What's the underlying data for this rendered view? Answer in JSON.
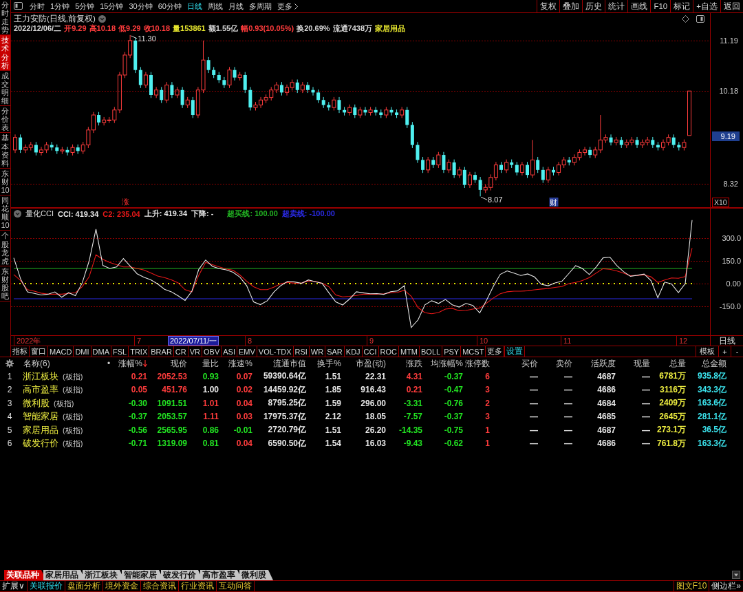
{
  "sidebar": {
    "items": [
      {
        "label": "分时走势",
        "selected": false
      },
      {
        "label": "技术分析",
        "selected": true
      },
      {
        "label": "成交明细",
        "selected": false
      },
      {
        "label": "分价表",
        "selected": false
      },
      {
        "label": "基本资料",
        "selected": false
      },
      {
        "label": "东财10",
        "selected": false
      },
      {
        "label": "同花顺10",
        "selected": false
      },
      {
        "label": "个股龙虎",
        "selected": false
      },
      {
        "label": "东财股吧",
        "selected": false
      }
    ]
  },
  "toolbar": {
    "periods": [
      {
        "label": "分时",
        "selected": false
      },
      {
        "label": "1分钟",
        "selected": false
      },
      {
        "label": "5分钟",
        "selected": false
      },
      {
        "label": "15分钟",
        "selected": false
      },
      {
        "label": "30分钟",
        "selected": false
      },
      {
        "label": "60分钟",
        "selected": false
      },
      {
        "label": "日线",
        "selected": true
      },
      {
        "label": "周线",
        "selected": false
      },
      {
        "label": "月线",
        "selected": false
      },
      {
        "label": "多周期",
        "selected": false
      }
    ],
    "more": "更多",
    "actions": [
      "复权",
      "叠加",
      "历史",
      "统计",
      "画线",
      "F10",
      "标记",
      "+自选",
      "返回"
    ]
  },
  "stock": {
    "title": "王力安防(日线,前复权)",
    "stats": [
      {
        "text": "2022/12/06/二",
        "color": "#d6d6d6"
      },
      {
        "text": "开9.29",
        "color": "#ff3c3c"
      },
      {
        "text": "高10.18",
        "color": "#ff3c3c"
      },
      {
        "text": "低9.29",
        "color": "#ff3c3c"
      },
      {
        "text": "收10.18",
        "color": "#ff3c3c"
      },
      {
        "text": "量153861",
        "color": "#e6e62e"
      },
      {
        "text": "额1.55亿",
        "color": "#d6d6d6"
      },
      {
        "text": "幅0.93(10.05%)",
        "color": "#ff3c3c"
      },
      {
        "text": "换20.69%",
        "color": "#d6d6d6"
      },
      {
        "text": "流通7438万",
        "color": "#d6d6d6"
      },
      {
        "text": "家居用品",
        "color": "#e6e62e"
      }
    ]
  },
  "price_chart": {
    "cursor_price": "9.19",
    "scale": "X10",
    "markers": [
      {
        "text": "涨",
        "kind": "limit"
      },
      {
        "text": "财",
        "kind": "finance"
      }
    ],
    "chart_data": {
      "type": "candlestick",
      "ohlc": [
        [
          9.0,
          9.31,
          8.94,
          9.25
        ],
        [
          9.25,
          9.31,
          8.94,
          9.0
        ],
        [
          9.0,
          9.11,
          8.94,
          9.05
        ],
        [
          9.05,
          9.16,
          8.99,
          9.1
        ],
        [
          9.1,
          9.16,
          8.89,
          8.95
        ],
        [
          8.95,
          9.06,
          8.89,
          9.0
        ],
        [
          9.0,
          9.16,
          8.94,
          9.1
        ],
        [
          9.1,
          9.16,
          8.99,
          9.05
        ],
        [
          9.05,
          9.11,
          8.92,
          8.98
        ],
        [
          8.98,
          9.06,
          8.92,
          9.0
        ],
        [
          9.0,
          9.06,
          8.89,
          8.95
        ],
        [
          8.95,
          9.11,
          8.89,
          9.05
        ],
        [
          9.05,
          9.11,
          8.92,
          8.98
        ],
        [
          8.98,
          9.16,
          8.92,
          9.1
        ],
        [
          9.1,
          9.46,
          9.04,
          9.4
        ],
        [
          9.4,
          9.76,
          9.34,
          9.7
        ],
        [
          9.7,
          9.76,
          9.49,
          9.55
        ],
        [
          9.55,
          9.66,
          9.49,
          9.6
        ],
        [
          9.6,
          9.66,
          9.54,
          9.6
        ],
        [
          9.6,
          9.86,
          9.54,
          9.8
        ],
        [
          9.8,
          10.56,
          9.74,
          10.5
        ],
        [
          10.5,
          10.96,
          10.44,
          10.9
        ],
        [
          10.9,
          11.3,
          10.84,
          11.19
        ],
        [
          11.19,
          11.25,
          10.54,
          10.6
        ],
        [
          10.6,
          10.66,
          10.24,
          10.3
        ],
        [
          10.3,
          10.56,
          10.24,
          10.5
        ],
        [
          10.5,
          10.56,
          10.04,
          10.1
        ],
        [
          10.1,
          10.26,
          10.04,
          10.2
        ],
        [
          10.2,
          10.26,
          9.94,
          10.0
        ],
        [
          10.0,
          10.36,
          9.94,
          10.3
        ],
        [
          10.3,
          10.36,
          10.04,
          10.1
        ],
        [
          10.1,
          10.26,
          10.04,
          10.2
        ],
        [
          10.2,
          10.26,
          9.84,
          9.9
        ],
        [
          9.9,
          10.06,
          9.84,
          10.0
        ],
        [
          10.0,
          10.06,
          9.64,
          9.7
        ],
        [
          9.7,
          10.26,
          9.64,
          10.2
        ],
        [
          10.2,
          11.19,
          10.14,
          10.8
        ],
        [
          10.8,
          10.86,
          10.54,
          10.6
        ],
        [
          10.6,
          10.66,
          10.44,
          10.5
        ],
        [
          10.5,
          10.56,
          10.34,
          10.4
        ],
        [
          10.4,
          10.46,
          10.24,
          10.3
        ],
        [
          10.3,
          10.66,
          10.24,
          10.6
        ],
        [
          10.6,
          10.66,
          10.39,
          10.45
        ],
        [
          10.45,
          10.56,
          10.39,
          10.5
        ],
        [
          10.5,
          10.56,
          10.14,
          10.2
        ],
        [
          10.2,
          10.26,
          9.79,
          9.85
        ],
        [
          9.85,
          9.96,
          9.79,
          9.9
        ],
        [
          9.9,
          10.06,
          9.84,
          10.0
        ],
        [
          10.0,
          10.11,
          9.94,
          10.05
        ],
        [
          10.05,
          10.26,
          9.99,
          10.2
        ],
        [
          10.2,
          10.36,
          10.14,
          10.3
        ],
        [
          10.3,
          10.36,
          10.09,
          10.15
        ],
        [
          10.15,
          10.31,
          10.09,
          10.25
        ],
        [
          10.25,
          10.41,
          10.19,
          10.35
        ],
        [
          10.35,
          10.41,
          10.14,
          10.2
        ],
        [
          10.2,
          10.36,
          10.14,
          10.3
        ],
        [
          10.3,
          10.36,
          10.14,
          10.2
        ],
        [
          10.2,
          10.26,
          10.09,
          10.15
        ],
        [
          10.15,
          10.21,
          9.94,
          10.0
        ],
        [
          10.0,
          10.06,
          9.84,
          9.9
        ],
        [
          9.9,
          9.96,
          9.79,
          9.85
        ],
        [
          9.85,
          10.06,
          9.79,
          10.0
        ],
        [
          10.0,
          10.06,
          9.74,
          9.8
        ],
        [
          9.8,
          9.86,
          9.69,
          9.75
        ],
        [
          9.75,
          9.91,
          9.69,
          9.85
        ],
        [
          9.85,
          9.91,
          9.64,
          9.7
        ],
        [
          9.7,
          9.86,
          9.64,
          9.8
        ],
        [
          9.8,
          9.86,
          9.69,
          9.75
        ],
        [
          9.75,
          9.86,
          9.69,
          9.8
        ],
        [
          9.8,
          9.86,
          9.69,
          9.75
        ],
        [
          9.75,
          9.81,
          9.64,
          9.7
        ],
        [
          9.7,
          9.86,
          9.64,
          9.8
        ],
        [
          9.8,
          9.86,
          9.69,
          9.75
        ],
        [
          9.75,
          9.81,
          9.64,
          9.7
        ],
        [
          9.7,
          9.86,
          9.64,
          9.8
        ],
        [
          9.8,
          9.86,
          9.44,
          9.5
        ],
        [
          9.5,
          9.56,
          9.04,
          9.1
        ],
        [
          9.1,
          9.16,
          8.74,
          8.8
        ],
        [
          8.8,
          8.86,
          8.54,
          8.6
        ],
        [
          8.6,
          8.86,
          8.54,
          8.8
        ],
        [
          8.8,
          8.86,
          8.64,
          8.7
        ],
        [
          8.7,
          8.96,
          8.64,
          8.9
        ],
        [
          8.9,
          8.96,
          8.54,
          8.6
        ],
        [
          8.6,
          8.81,
          8.54,
          8.75
        ],
        [
          8.75,
          8.81,
          8.44,
          8.5
        ],
        [
          8.5,
          8.66,
          8.44,
          8.6
        ],
        [
          8.6,
          8.66,
          8.24,
          8.3
        ],
        [
          8.3,
          8.56,
          8.24,
          8.5
        ],
        [
          8.5,
          8.56,
          8.34,
          8.4
        ],
        [
          8.4,
          8.46,
          8.07,
          8.2
        ],
        [
          8.2,
          8.31,
          8.14,
          8.25
        ],
        [
          8.25,
          8.51,
          8.19,
          8.45
        ],
        [
          8.45,
          8.76,
          8.39,
          8.7
        ],
        [
          8.7,
          8.76,
          8.54,
          8.6
        ],
        [
          8.6,
          8.81,
          8.54,
          8.75
        ],
        [
          8.75,
          8.81,
          8.64,
          8.7
        ],
        [
          8.7,
          8.76,
          8.49,
          8.55
        ],
        [
          8.55,
          8.76,
          8.49,
          8.7
        ],
        [
          8.7,
          8.76,
          8.44,
          8.5
        ],
        [
          8.5,
          9.2,
          8.44,
          8.8
        ],
        [
          8.8,
          8.86,
          8.54,
          8.6
        ],
        [
          8.6,
          8.66,
          8.34,
          8.4
        ],
        [
          8.4,
          8.66,
          8.34,
          8.6
        ],
        [
          8.6,
          8.66,
          8.49,
          8.55
        ],
        [
          8.55,
          8.76,
          8.49,
          8.7
        ],
        [
          8.7,
          8.86,
          8.64,
          8.8
        ],
        [
          8.8,
          8.86,
          8.69,
          8.75
        ],
        [
          8.75,
          8.91,
          8.69,
          8.85
        ],
        [
          8.85,
          9.01,
          8.79,
          8.95
        ],
        [
          8.95,
          9.06,
          8.89,
          9.0
        ],
        [
          9.0,
          9.06,
          8.84,
          8.9
        ],
        [
          8.9,
          9.06,
          8.84,
          9.0
        ],
        [
          9.0,
          9.7,
          8.94,
          9.2
        ],
        [
          9.2,
          9.31,
          9.14,
          9.25
        ],
        [
          9.25,
          9.31,
          9.09,
          9.15
        ],
        [
          9.15,
          9.26,
          9.09,
          9.2
        ],
        [
          9.2,
          9.26,
          9.04,
          9.1
        ],
        [
          9.1,
          9.21,
          9.04,
          9.15
        ],
        [
          9.15,
          9.26,
          9.09,
          9.2
        ],
        [
          9.2,
          9.26,
          9.04,
          9.1
        ],
        [
          9.1,
          9.21,
          9.04,
          9.15
        ],
        [
          9.15,
          9.26,
          9.09,
          9.2
        ],
        [
          9.2,
          9.26,
          9.04,
          9.1
        ],
        [
          9.1,
          9.16,
          8.99,
          9.05
        ],
        [
          9.05,
          9.21,
          8.99,
          9.15
        ],
        [
          9.15,
          9.31,
          9.09,
          9.25
        ],
        [
          9.25,
          9.31,
          9.04,
          9.1
        ],
        [
          9.1,
          9.16,
          8.99,
          9.05
        ],
        [
          9.05,
          9.21,
          8.99,
          9.15
        ],
        [
          9.29,
          10.18,
          9.29,
          10.18
        ]
      ],
      "ylim": [
        7.84,
        11.74
      ],
      "yticks": [
        11.19,
        10.18,
        8.32
      ],
      "grid": true,
      "annotations": [
        "11.30",
        "8.07"
      ]
    }
  },
  "indicator": {
    "name": "量化CCI",
    "values": [
      {
        "label": "CCI:",
        "value": "419.34",
        "color": "#e6e6e6"
      },
      {
        "label": "C2:",
        "value": "235.04",
        "color": "#e81818"
      },
      {
        "label": "上升:",
        "value": "419.34",
        "color": "#e6e6e6"
      },
      {
        "label": "下降:",
        "value": "-",
        "color": "#e6e6e6"
      },
      {
        "label": "超买线:",
        "value": "100.00",
        "color": "#22b422"
      },
      {
        "label": "超卖线:",
        "value": "-100.00",
        "color": "#2a2ae6"
      }
    ],
    "chart_data": {
      "type": "line",
      "series": [
        {
          "color": "#e6e6e6",
          "values": [
            170,
            30,
            -55,
            -65,
            -75,
            -70,
            -55,
            -90,
            -60,
            -80,
            5,
            150,
            360,
            120,
            100,
            110,
            165,
            115,
            65,
            42,
            25,
            -2,
            -37,
            -54,
            -81,
            -111,
            -50,
            94,
            156,
            114,
            99,
            91,
            75,
            43,
            -14,
            -121,
            -139,
            -113,
            -54,
            -12,
            16,
            11,
            2,
            24,
            13,
            2,
            -61,
            -121,
            -141,
            -102,
            -54,
            -61,
            -67,
            -66,
            -71,
            -53,
            -48,
            -14,
            -290,
            -240,
            -140,
            -113,
            -131,
            -105,
            -140,
            -155,
            -131,
            -144,
            -193,
            -110,
            -17,
            61,
            84,
            69,
            53,
            64,
            44,
            -5,
            -14,
            5,
            16,
            66,
            118,
            100,
            60,
            110,
            170,
            175,
            120,
            79,
            48,
            55,
            63,
            20,
            -93,
            10,
            -2,
            -60,
            0,
            419
          ]
        },
        {
          "color": "#e81818",
          "values": [
            60,
            20,
            -40,
            -50,
            -63,
            -70,
            -70,
            -70,
            -65,
            -60,
            -20,
            45,
            190,
            160,
            140,
            125,
            110,
            110,
            100,
            90,
            70,
            50,
            40,
            25,
            5,
            -40,
            -55,
            55,
            140,
            125,
            110,
            97,
            88,
            57,
            15,
            -20,
            -40,
            -40,
            -22,
            0,
            8,
            3,
            4,
            18,
            15,
            3,
            -20,
            -75,
            -87,
            -84,
            -78,
            -70,
            -70,
            -70,
            -67,
            -61,
            -58,
            -44,
            -83,
            -158,
            -192,
            -199,
            -191,
            -168,
            -163,
            -179,
            -177,
            -168,
            -161,
            -129,
            -95,
            -67,
            -54,
            -50,
            -50,
            -47,
            -41,
            -36,
            -32,
            -25,
            -19,
            0,
            8,
            20,
            40,
            70,
            98,
            94,
            84,
            69,
            52,
            54,
            58,
            45,
            8,
            24,
            38,
            35,
            47,
            235
          ]
        }
      ],
      "ylim": [
        -409,
        500
      ],
      "yticks": [
        {
          "value": 300,
          "label": "300.0"
        },
        {
          "value": 150,
          "label": "150.0"
        },
        {
          "value": 0,
          "label": "0.00"
        },
        {
          "value": -150,
          "label": "-150.0"
        }
      ],
      "grid": true,
      "ref_lines": [
        {
          "axis": "y",
          "value": 100
        },
        {
          "axis": "y",
          "value": -100
        },
        {
          "axis": "y",
          "value": 0
        }
      ]
    }
  },
  "time_axis": {
    "labels": [
      {
        "text": "2022年",
        "kind": "year"
      },
      {
        "text": "7",
        "kind": "month"
      },
      {
        "text": "2022/07/11/一",
        "kind": "cursor"
      },
      {
        "text": "8",
        "kind": "month"
      },
      {
        "text": "9",
        "kind": "month"
      },
      {
        "text": "10",
        "kind": "month"
      },
      {
        "text": "11",
        "kind": "month"
      },
      {
        "text": "12",
        "kind": "month"
      }
    ],
    "period": "日线"
  },
  "indicator_tabs": {
    "items": [
      {
        "label": "指标",
        "kind": "tab"
      },
      {
        "label": "窗口",
        "kind": "tab"
      },
      {
        "label": "MACD",
        "kind": "tab"
      },
      {
        "label": "DMI",
        "kind": "tab"
      },
      {
        "label": "DMA",
        "kind": "tab"
      },
      {
        "label": "FSL",
        "kind": "tab"
      },
      {
        "label": "TRIX",
        "kind": "tab"
      },
      {
        "label": "BRAR",
        "kind": "tab"
      },
      {
        "label": "CR",
        "kind": "tab"
      },
      {
        "label": "VR",
        "kind": "tab"
      },
      {
        "label": "OBV",
        "kind": "tab"
      },
      {
        "label": "ASI",
        "kind": "tab"
      },
      {
        "label": "EMV",
        "kind": "tab"
      },
      {
        "label": "VOL-TDX",
        "kind": "tab"
      },
      {
        "label": "RSI",
        "kind": "tab"
      },
      {
        "label": "WR",
        "kind": "tab"
      },
      {
        "label": "SAR",
        "kind": "tab"
      },
      {
        "label": "KDJ",
        "kind": "tab"
      },
      {
        "label": "CCI",
        "kind": "tab"
      },
      {
        "label": "ROC",
        "kind": "tab"
      },
      {
        "label": "MTM",
        "kind": "tab"
      },
      {
        "label": "BOLL",
        "kind": "tab"
      },
      {
        "label": "PSY",
        "kind": "tab"
      },
      {
        "label": "MCST",
        "kind": "tab"
      },
      {
        "label": "更多",
        "kind": "tab"
      },
      {
        "label": "设置",
        "kind": "action"
      }
    ],
    "controls": [
      "模板",
      "+",
      "-"
    ]
  },
  "table": {
    "name_column": "名称(6)",
    "marker_column": "•",
    "columns": [
      {
        "label": "涨幅%",
        "kind": "trend",
        "sorted": true
      },
      {
        "label": "现价",
        "kind": "trend",
        "sorted": false
      },
      {
        "label": "量比",
        "kind": "trend",
        "sorted": false
      },
      {
        "label": "涨速%",
        "kind": "trend",
        "sorted": false
      },
      {
        "label": "流通市值",
        "kind": "plain",
        "sorted": false
      },
      {
        "label": "换手%",
        "kind": "plain",
        "sorted": false
      },
      {
        "label": "市盈(动)",
        "kind": "plain",
        "sorted": false
      },
      {
        "label": "涨跌",
        "kind": "trend",
        "sorted": false
      },
      {
        "label": "均涨幅%",
        "kind": "trend",
        "sorted": false
      },
      {
        "label": "涨停数",
        "kind": "count",
        "sorted": false
      },
      {
        "label": "买价",
        "kind": "plain",
        "sorted": false
      },
      {
        "label": "卖价",
        "kind": "plain",
        "sorted": false
      },
      {
        "label": "活跃度",
        "kind": "plain",
        "sorted": false
      },
      {
        "label": "现量",
        "kind": "plain",
        "sorted": false
      },
      {
        "label": "总量",
        "kind": "volume",
        "sorted": false
      },
      {
        "label": "总金额",
        "kind": "amount",
        "sorted": false
      }
    ],
    "rows": [
      {
        "index": "1",
        "name": "浙江板块",
        "tag": "(板指)",
        "cells": [
          {
            "text": "0.21",
            "color": "#ff3c3c"
          },
          {
            "text": "2052.53",
            "color": "#ff3c3c"
          },
          {
            "text": "0.93",
            "color": "#22e622"
          },
          {
            "text": "0.07",
            "color": "#ff3c3c"
          },
          {
            "text": "59390.64亿"
          },
          {
            "text": "1.51"
          },
          {
            "text": "22.31"
          },
          {
            "text": "4.31",
            "color": "#ff3c3c"
          },
          {
            "text": "-0.37",
            "color": "#22e622"
          },
          {
            "text": "6",
            "color": "#ff3c3c"
          },
          {
            "text": "—"
          },
          {
            "text": "—"
          },
          {
            "text": "4687"
          },
          {
            "text": "—"
          },
          {
            "text": "6781万"
          },
          {
            "text": "935.8亿"
          }
        ]
      },
      {
        "index": "2",
        "name": "高市盈率",
        "tag": "(板指)",
        "cells": [
          {
            "text": "0.05",
            "color": "#ff3c3c"
          },
          {
            "text": "451.76",
            "color": "#ff3c3c"
          },
          {
            "text": "1.00",
            "color": "#e8e8e8"
          },
          {
            "text": "0.02",
            "color": "#ff3c3c"
          },
          {
            "text": "14459.92亿"
          },
          {
            "text": "1.85"
          },
          {
            "text": "916.43"
          },
          {
            "text": "0.21",
            "color": "#ff3c3c"
          },
          {
            "text": "-0.47",
            "color": "#22e622"
          },
          {
            "text": "3",
            "color": "#ff3c3c"
          },
          {
            "text": "—"
          },
          {
            "text": "—"
          },
          {
            "text": "4686"
          },
          {
            "text": "—"
          },
          {
            "text": "3116万"
          },
          {
            "text": "343.3亿"
          }
        ]
      },
      {
        "index": "3",
        "name": "微利股",
        "tag": "(板指)",
        "cells": [
          {
            "text": "-0.30",
            "color": "#22e622"
          },
          {
            "text": "1091.51",
            "color": "#22e622"
          },
          {
            "text": "1.01",
            "color": "#ff3c3c"
          },
          {
            "text": "0.04",
            "color": "#ff3c3c"
          },
          {
            "text": "8795.25亿"
          },
          {
            "text": "1.59"
          },
          {
            "text": "296.00"
          },
          {
            "text": "-3.31",
            "color": "#22e622"
          },
          {
            "text": "-0.76",
            "color": "#22e622"
          },
          {
            "text": "2",
            "color": "#ff3c3c"
          },
          {
            "text": "—"
          },
          {
            "text": "—"
          },
          {
            "text": "4684"
          },
          {
            "text": "—"
          },
          {
            "text": "2409万"
          },
          {
            "text": "163.6亿"
          }
        ]
      },
      {
        "index": "4",
        "name": "智能家居",
        "tag": "(板指)",
        "cells": [
          {
            "text": "-0.37",
            "color": "#22e622"
          },
          {
            "text": "2053.57",
            "color": "#22e622"
          },
          {
            "text": "1.11",
            "color": "#ff3c3c"
          },
          {
            "text": "0.03",
            "color": "#ff3c3c"
          },
          {
            "text": "17975.37亿"
          },
          {
            "text": "2.12"
          },
          {
            "text": "18.05"
          },
          {
            "text": "-7.57",
            "color": "#22e622"
          },
          {
            "text": "-0.37",
            "color": "#22e622"
          },
          {
            "text": "3",
            "color": "#ff3c3c"
          },
          {
            "text": "—"
          },
          {
            "text": "—"
          },
          {
            "text": "4685"
          },
          {
            "text": "—"
          },
          {
            "text": "2645万"
          },
          {
            "text": "281.1亿"
          }
        ]
      },
      {
        "index": "5",
        "name": "家居用品",
        "tag": "(板指)",
        "cells": [
          {
            "text": "-0.56",
            "color": "#22e622"
          },
          {
            "text": "2565.95",
            "color": "#22e622"
          },
          {
            "text": "0.86",
            "color": "#22e622"
          },
          {
            "text": "-0.01",
            "color": "#22e622"
          },
          {
            "text": "2720.79亿"
          },
          {
            "text": "1.51"
          },
          {
            "text": "26.20"
          },
          {
            "text": "-14.35",
            "color": "#22e622"
          },
          {
            "text": "-0.75",
            "color": "#22e622"
          },
          {
            "text": "1",
            "color": "#ff3c3c"
          },
          {
            "text": "—"
          },
          {
            "text": "—"
          },
          {
            "text": "4687"
          },
          {
            "text": "—"
          },
          {
            "text": "273.1万"
          },
          {
            "text": "36.5亿"
          }
        ]
      },
      {
        "index": "6",
        "name": "破发行价",
        "tag": "(板指)",
        "cells": [
          {
            "text": "-0.71",
            "color": "#22e622"
          },
          {
            "text": "1319.09",
            "color": "#22e622"
          },
          {
            "text": "0.81",
            "color": "#22e622"
          },
          {
            "text": "0.04",
            "color": "#ff3c3c"
          },
          {
            "text": "6590.50亿"
          },
          {
            "text": "1.54"
          },
          {
            "text": "16.03"
          },
          {
            "text": "-9.43",
            "color": "#22e622"
          },
          {
            "text": "-0.62",
            "color": "#22e622"
          },
          {
            "text": "1",
            "color": "#ff3c3c"
          },
          {
            "text": "—"
          },
          {
            "text": "—"
          },
          {
            "text": "4686"
          },
          {
            "text": "—"
          },
          {
            "text": "761.8万"
          },
          {
            "text": "163.3亿"
          }
        ]
      }
    ]
  },
  "related_tabs": [
    {
      "label": "关联品种",
      "selected": true
    },
    {
      "label": "家居用品",
      "selected": false
    },
    {
      "label": "浙江板块",
      "selected": false
    },
    {
      "label": "智能家居",
      "selected": false
    },
    {
      "label": "破发行价",
      "selected": false
    },
    {
      "label": "高市盈率",
      "selected": false
    },
    {
      "label": "微利股",
      "selected": false
    }
  ],
  "bottom_bar": {
    "expand": "扩展∨",
    "items": [
      {
        "label": "关联报价",
        "selected": true
      },
      {
        "label": "盘面分析",
        "selected": false
      },
      {
        "label": "境外资金",
        "selected": false
      },
      {
        "label": "综合资讯",
        "selected": false
      },
      {
        "label": "行业资讯",
        "selected": false
      },
      {
        "label": "互动问答",
        "selected": false
      }
    ],
    "right": [
      {
        "label": "图文F10",
        "kind": "link"
      },
      {
        "label": "侧边栏»",
        "kind": "toggle"
      }
    ]
  }
}
